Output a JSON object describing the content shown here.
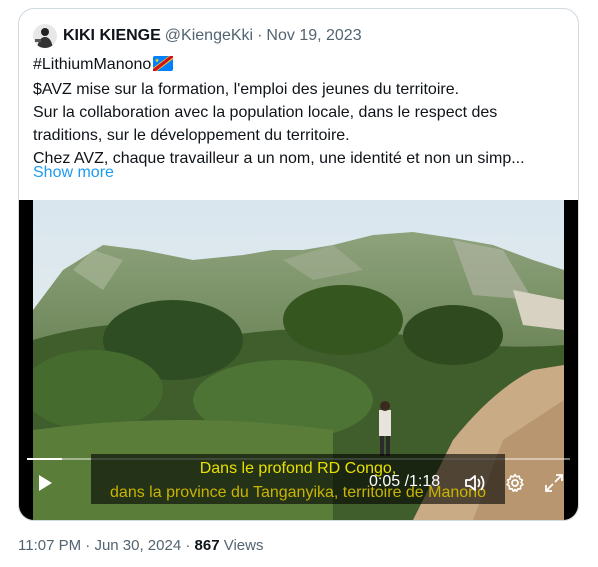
{
  "tweet": {
    "author_name": "KIKI KIENGE",
    "handle": "@KiengeKki",
    "separator": "·",
    "date": "Nov 19, 2023",
    "lines": [
      "#LithiumManono",
      "$AVZ mise sur la formation, l'emploi des jeunes du territoire.",
      "Sur la collaboration avec la population locale, dans le respect des",
      "traditions, sur le développement du territoire.",
      "Chez AVZ, chaque travailleur a un nom, une identité et non un simp..."
    ],
    "show_more": "Show more"
  },
  "video": {
    "subtitle_line1": "Dans le profond RD Congo,",
    "subtitle_line2": "dans la province du Tanganyika, territoire de Manono",
    "current_time": "0:05",
    "time_separator": "/",
    "duration": "1:18",
    "progress": 0.064
  },
  "footer": {
    "time": "11:07 PM",
    "separator1": "·",
    "date": "Jun 30, 2024",
    "separator2": "·",
    "views_count": "867",
    "views_label": "Views"
  },
  "colors": {
    "link": "#1d9bf0",
    "secondary_text": "#536471",
    "subtitle": "#e8e000"
  }
}
